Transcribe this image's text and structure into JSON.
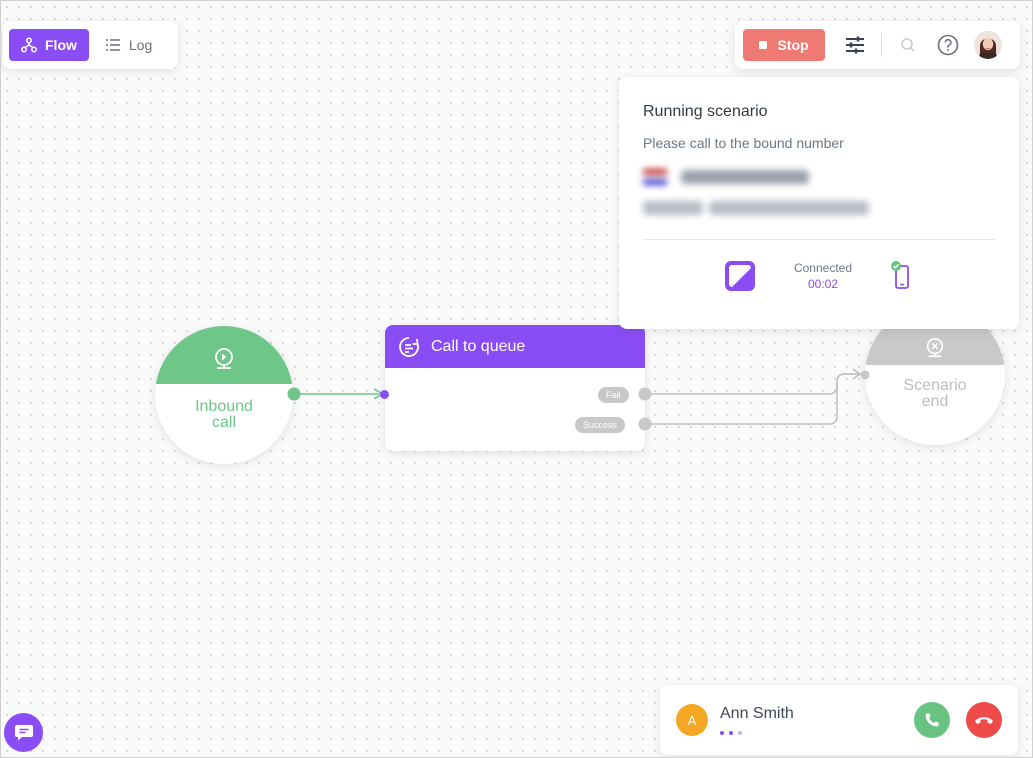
{
  "tabs": [
    {
      "label": "Flow",
      "icon": "flow-icon",
      "active": true
    },
    {
      "label": "Log",
      "icon": "list-icon",
      "active": false
    }
  ],
  "toolbar": {
    "stop_label": "Stop",
    "icons": [
      "settings-sliders-icon",
      "search-icon",
      "help-icon",
      "user-avatar"
    ]
  },
  "panel": {
    "title": "Running scenario",
    "subtitle": "Please call to the bound number",
    "status_label": "Connected",
    "status_time": "00:02"
  },
  "nodes": {
    "inbound": {
      "label": "Inbound call",
      "color": "#6ec788"
    },
    "queue": {
      "title": "Call to queue",
      "outputs": [
        "Fail",
        "Success"
      ],
      "color": "#8a4df5"
    },
    "end": {
      "label": "Scenario end",
      "color": "#c9c9c9"
    }
  },
  "call": {
    "avatar_letter": "A",
    "name": "Ann Smith"
  },
  "colors": {
    "accent": "#8a4df5",
    "stop": "#ef7a74",
    "accept": "#67c37f",
    "decline": "#f04b4b"
  }
}
